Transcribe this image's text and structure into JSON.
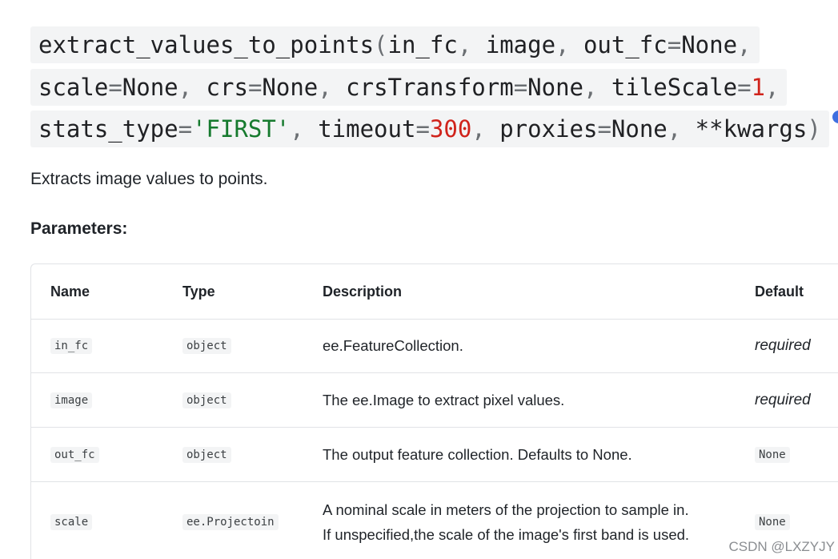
{
  "signature": {
    "line1": {
      "fn": "extract_values_to_points",
      "p1": "(",
      "a1": "in_fc",
      "p2": ", ",
      "a2": "image",
      "p3": ", ",
      "a3": "out_fc",
      "p4": "=",
      "v3": "None",
      "p5": ","
    },
    "line2": {
      "a1": "scale",
      "p1": "=",
      "v1": "None",
      "p2": ", ",
      "a2": "crs",
      "p3": "=",
      "v2": "None",
      "p4": ", ",
      "a3": "crsTransform",
      "p5": "=",
      "v3": "None",
      "p6": ", ",
      "a4": "tileScale",
      "p7": "=",
      "v4": "1",
      "p8": ","
    },
    "line3": {
      "a1": "stats_type",
      "p1": "=",
      "v1": "'FIRST'",
      "p2": ", ",
      "a2": "timeout",
      "p3": "=",
      "v2": "300",
      "p4": ", ",
      "a3": "proxies",
      "p5": "=",
      "v3": "None",
      "p6": ", ",
      "a4": "**kwargs",
      "p7": ")"
    }
  },
  "summary": "Extracts image values to points.",
  "parameters_heading": "Parameters:",
  "table": {
    "headers": {
      "name": "Name",
      "type": "Type",
      "description": "Description",
      "default": "Default"
    },
    "rows": [
      {
        "name": "in_fc",
        "type": "object",
        "description_line1": "ee.FeatureCollection.",
        "description_line2": "",
        "default": "required",
        "default_style": "italic"
      },
      {
        "name": "image",
        "type": "object",
        "description_line1": "The ee.Image to extract pixel values.",
        "description_line2": "",
        "default": "required",
        "default_style": "italic"
      },
      {
        "name": "out_fc",
        "type": "object",
        "description_line1": "The output feature collection. Defaults to None.",
        "description_line2": "",
        "default": "None",
        "default_style": "code"
      },
      {
        "name": "scale",
        "type": "ee.Projectoin",
        "description_line1": "A nominal scale in meters of the projection to sample in.",
        "description_line2": "If unspecified,the scale of the image's first band is used.",
        "default": "None",
        "default_style": "code"
      }
    ]
  },
  "watermark": "CSDN @LXZYJY",
  "colors": {
    "code_bg": "#f3f4f5",
    "number": "#d0231b",
    "string": "#167a2e",
    "punctuation": "#6b6f73",
    "border": "#e1e3e6",
    "accent_dot": "#3f6fe0"
  }
}
